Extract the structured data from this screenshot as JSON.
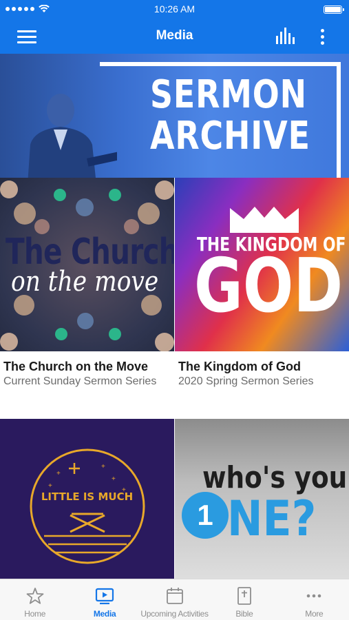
{
  "status_bar": {
    "time": "10:26 AM"
  },
  "nav": {
    "title": "Media"
  },
  "banner": {
    "line1": "SERMON",
    "line2": "ARCHIVE"
  },
  "series": [
    {
      "title": "The Church on the Move",
      "subtitle": "Current Sunday Sermon Series",
      "art_line1": "The Church",
      "art_line2": "on the move"
    },
    {
      "title": "The Kingdom of God",
      "subtitle": "2020 Spring Sermon Series",
      "art_line1": "THE KINGDOM OF",
      "art_line2": "GOD"
    },
    {
      "art_line1": "LITTLE IS MUCH"
    },
    {
      "art_line1": "who's your",
      "art_line2": "NE?",
      "art_badge": "1"
    }
  ],
  "tabs": [
    {
      "label": "Home",
      "icon": "star-icon",
      "active": false
    },
    {
      "label": "Media",
      "icon": "play-screen-icon",
      "active": true
    },
    {
      "label": "Upcoming Activities",
      "icon": "calendar-icon",
      "active": false
    },
    {
      "label": "Bible",
      "icon": "bible-icon",
      "active": false
    },
    {
      "label": "More",
      "icon": "more-dots-icon",
      "active": false
    }
  ],
  "colors": {
    "brand": "#1476e8",
    "tab_inactive": "#8e8e8e"
  }
}
